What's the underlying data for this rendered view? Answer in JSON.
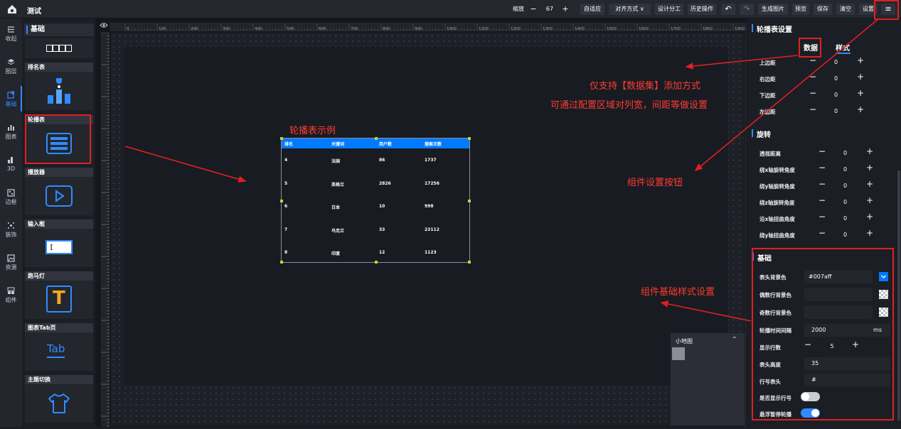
{
  "app": {
    "title": "测试"
  },
  "toolbar": {
    "zoom_label": "缩放",
    "zoom_value": "67",
    "minus": "−",
    "plus": "+",
    "buttons": [
      "自适应",
      "对齐方式 ∨",
      "设计分工",
      "历史操作",
      "生成图片",
      "预览",
      "保存",
      "清空",
      "设置"
    ],
    "undo": "↶",
    "redo": "↷",
    "menu": "≡"
  },
  "nav": [
    {
      "label": "收起",
      "icon": "collapse-icon"
    },
    {
      "label": "图层",
      "icon": "layers-icon"
    },
    {
      "label": "基础",
      "icon": "basic-icon"
    },
    {
      "label": "图表",
      "icon": "chart-icon"
    },
    {
      "label": "3D",
      "icon": "3d-icon"
    },
    {
      "label": "边框",
      "icon": "border-icon"
    },
    {
      "label": "装饰",
      "icon": "decoration-icon"
    },
    {
      "label": "资源",
      "icon": "resource-icon"
    },
    {
      "label": "组件",
      "icon": "component-icon"
    }
  ],
  "components": {
    "header": "基础",
    "items": [
      "排名表",
      "轮播表",
      "播放器",
      "输入框",
      "跑马灯",
      "图表Tab页",
      "主题切换"
    ],
    "tab_icon_text": "Tab",
    "input_icon_text": "I",
    "marquee_icon_text": "T"
  },
  "ruler": {
    "ticks": [
      "0",
      "100",
      "200",
      "300",
      "400",
      "500",
      "600",
      "700",
      "800",
      "900",
      "1000",
      "1100",
      "1200",
      "1300",
      "1400",
      "1500",
      "1600",
      "1700",
      "1800",
      "1900"
    ]
  },
  "table_example": {
    "headers": [
      "排名",
      "关键词",
      "用户数",
      "搜索次数"
    ],
    "rows": [
      [
        "4",
        "法国",
        "86",
        "1737"
      ],
      [
        "5",
        "英格兰",
        "2826",
        "17256"
      ],
      [
        "6",
        "日本",
        "10",
        "998"
      ],
      [
        "7",
        "乌克兰",
        "33",
        "23112"
      ],
      [
        "8",
        "印度",
        "12",
        "1123"
      ]
    ]
  },
  "minimap": {
    "title": "小地图",
    "chevron": "⌃"
  },
  "settings": {
    "carousel_title": "轮播表设置",
    "tabs": [
      "数据",
      "样式"
    ],
    "margins": [
      {
        "label": "上边距",
        "value": "0"
      },
      {
        "label": "右边距",
        "value": "0"
      },
      {
        "label": "下边距",
        "value": "0"
      },
      {
        "label": "左边距",
        "value": "0"
      }
    ],
    "rotate_title": "旋转",
    "rotate": [
      {
        "label": "透视距离",
        "value": "0"
      },
      {
        "label": "绕x轴旋转角度",
        "value": "0"
      },
      {
        "label": "绕y轴旋转角度",
        "value": "0"
      },
      {
        "label": "绕z轴旋转角度",
        "value": "0"
      },
      {
        "label": "沿x轴扭曲角度",
        "value": "0"
      },
      {
        "label": "绕y轴扭曲角度",
        "value": "0"
      }
    ],
    "basic_title": "基础",
    "header_bg_label": "表头背景色",
    "header_bg_value": "#007aff",
    "header_bg_color": "#007aff",
    "even_bg_label": "偶数行背景色",
    "odd_bg_label": "奇数行背景色",
    "interval_label": "轮播时间间隔",
    "interval_value": "2000",
    "interval_unit": "ms",
    "rows_label": "显示行数",
    "rows_value": "5",
    "header_height_label": "表头高度",
    "header_height_value": "35",
    "index_header_label": "行号表头",
    "index_header_value": "#",
    "show_index_label": "是否显示行号",
    "show_index_on": false,
    "hover_pause_label": "悬浮暂停轮播",
    "hover_pause_on": true
  },
  "annotations": {
    "example": "轮播表示例",
    "data_only": "仅支持【数据集】添加方式",
    "config": "可通过配置区域对列宽，间距等做设置",
    "settings_btn": "组件设置按钮",
    "basic_style": "组件基础样式设置"
  },
  "colors": {
    "accent": "#2f8cff",
    "annotation": "#ff3b30",
    "header_blue": "#007aff"
  }
}
